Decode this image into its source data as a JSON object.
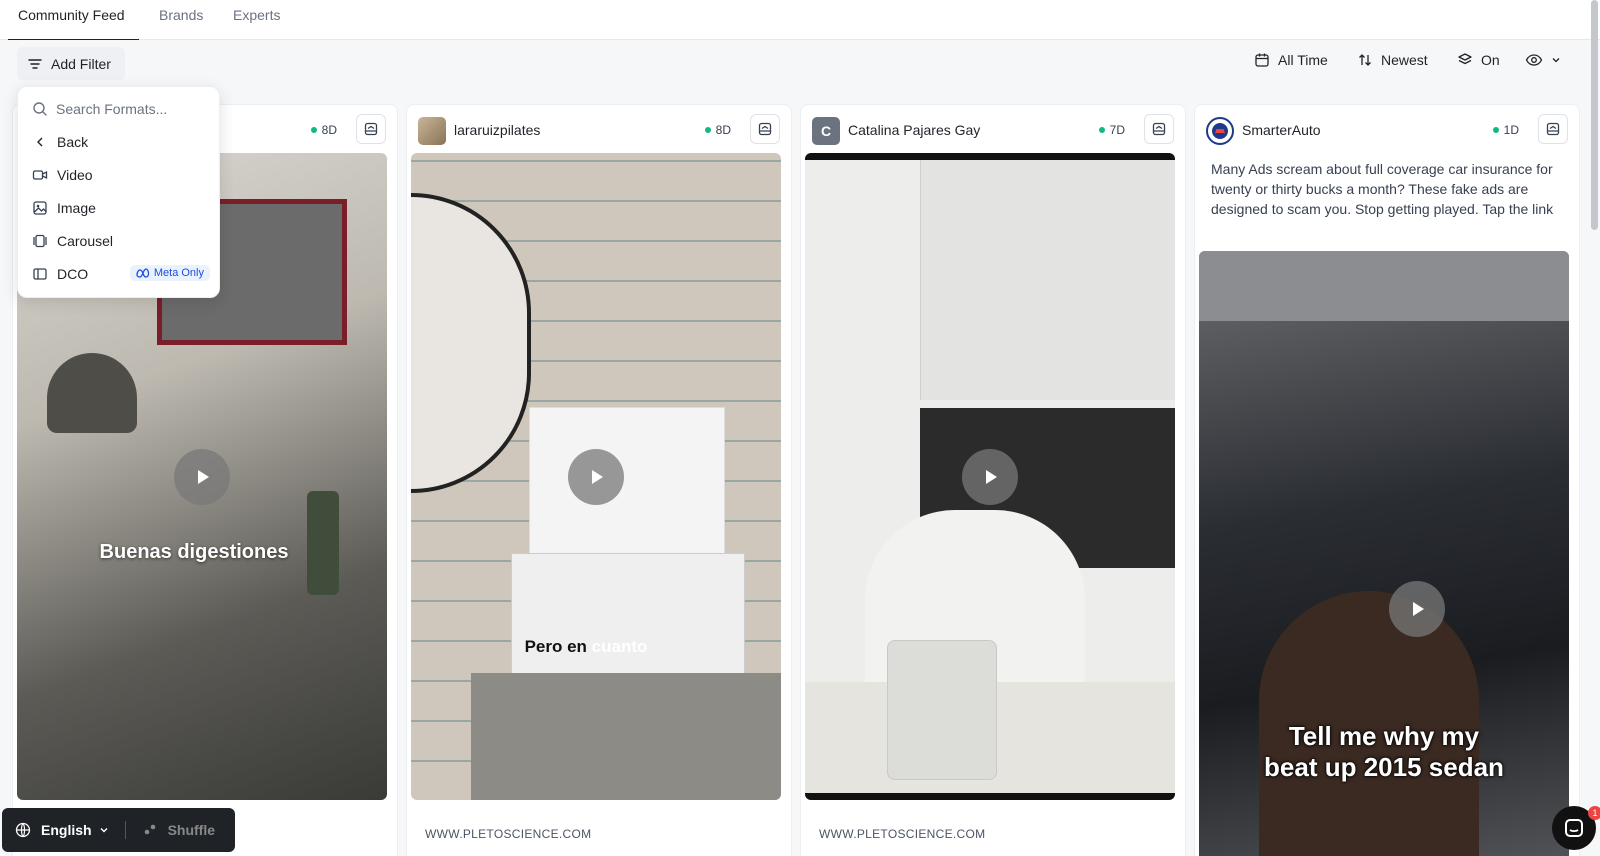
{
  "tabs": [
    {
      "label": "Community Feed",
      "active": true
    },
    {
      "label": "Brands",
      "active": false
    },
    {
      "label": "Experts",
      "active": false
    }
  ],
  "toolbar": {
    "add_filter": "Add Filter",
    "time_range": "All Time",
    "sort": "Newest",
    "layers_toggle": "On"
  },
  "format_menu": {
    "search_placeholder": "Search Formats...",
    "back_label": "Back",
    "items": [
      {
        "label": "Video",
        "icon": "video-icon"
      },
      {
        "label": "Image",
        "icon": "image-icon"
      },
      {
        "label": "Carousel",
        "icon": "carousel-icon"
      },
      {
        "label": "DCO",
        "icon": "dco-icon",
        "badge": "Meta Only"
      }
    ]
  },
  "cards": [
    {
      "author": "",
      "age": "8D",
      "caption": "Buenas digestiones",
      "url": ""
    },
    {
      "author": "lararuizpilates",
      "age": "8D",
      "caption_a": "Pero en ",
      "caption_b": "cuanto",
      "url": "WWW.PLETOSCIENCE.COM"
    },
    {
      "author": "Catalina Pajares Gay",
      "avatar_letter": "C",
      "age": "7D",
      "url": "WWW.PLETOSCIENCE.COM"
    },
    {
      "author": "SmarterAuto",
      "age": "1D",
      "text": "Many Ads scream about full coverage car insurance for twenty or thirty bucks a month? These fake ads are designed to scam you. Stop getting played. Tap the link",
      "caption_line1": "Tell me why my",
      "caption_line2": "beat up 2015 sedan"
    }
  ],
  "footer": {
    "language": "English",
    "shuffle": "Shuffle",
    "chat_badge": "1"
  },
  "colors": {
    "accent_green": "#10b981",
    "meta_blue": "#1d4ed8",
    "dark_bar": "#1f2328"
  }
}
